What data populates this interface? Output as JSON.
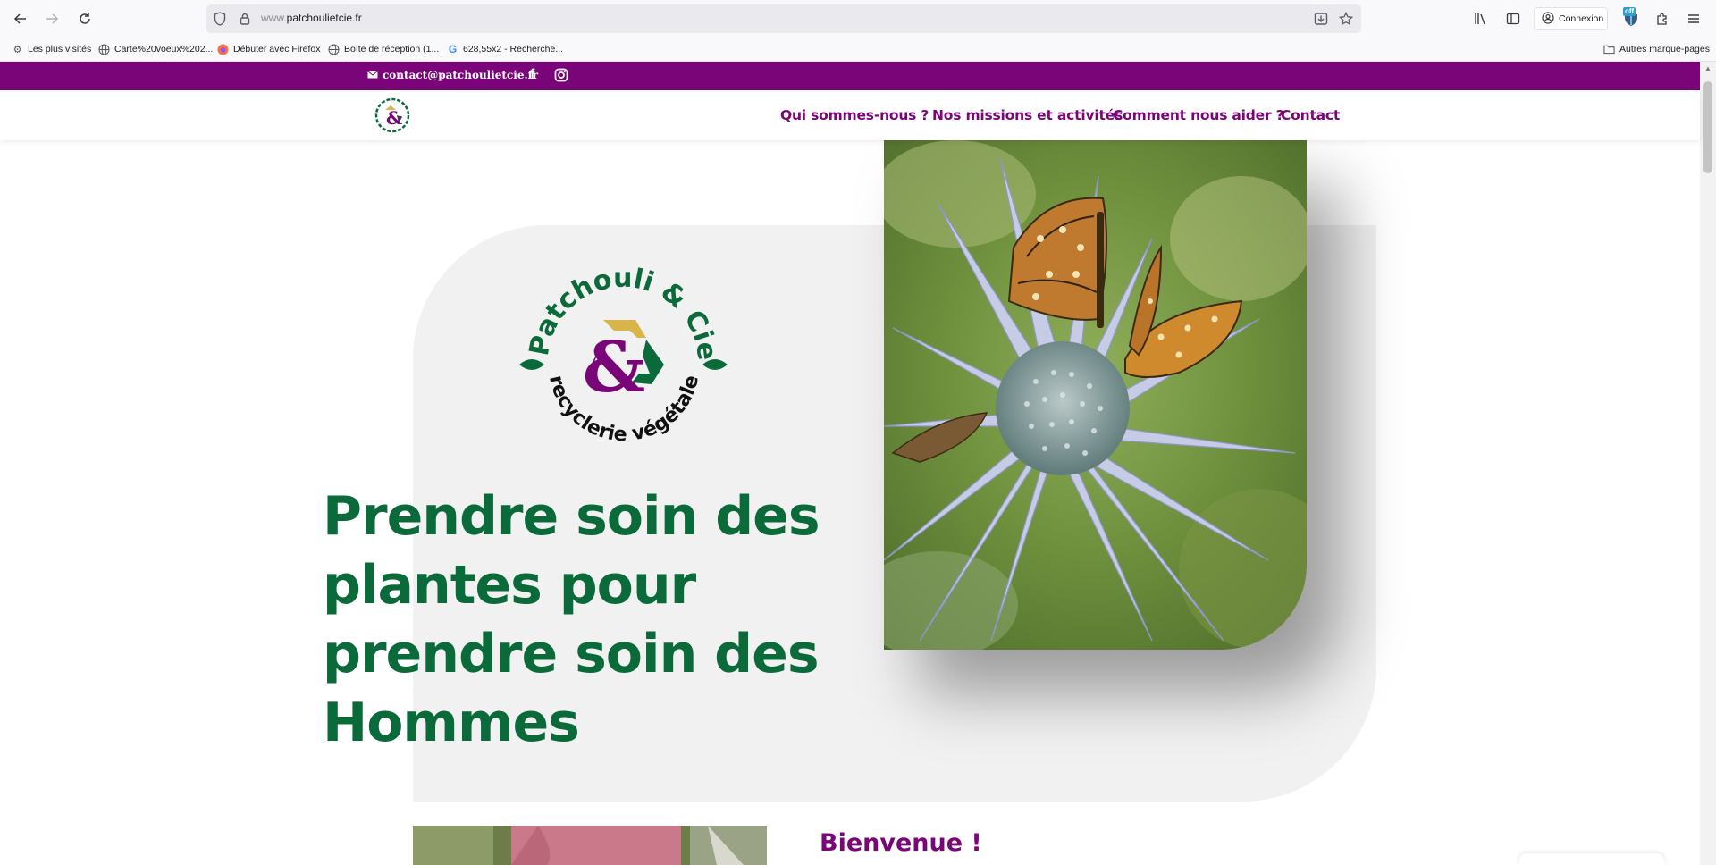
{
  "browser": {
    "url_prefix": "www.",
    "url_domain": "patchoulietcie.fr",
    "connexion_label": "Connexion",
    "extension_badge": "off",
    "bookmarks": [
      {
        "label": "Les plus visités",
        "icon": "gear-icon"
      },
      {
        "label": "Carte%20voeux%202...",
        "icon": "globe-icon"
      },
      {
        "label": "Débuter avec Firefox",
        "icon": "firefox-icon"
      },
      {
        "label": "Boîte de réception (1...",
        "icon": "globe-icon"
      },
      {
        "label": "628,55x2 - Recherche...",
        "icon": "google-icon"
      }
    ],
    "other_bookmarks_label": "Autres marque-pages"
  },
  "site": {
    "topbar": {
      "email": "contact@patchoulietcie.fr",
      "background": "#790579"
    },
    "menu": [
      "Qui sommes-nous ?",
      "Nos missions et activités",
      "Comment nous aider ?",
      "Contact"
    ],
    "logo": {
      "arc_text": "Patchouli & Cie",
      "bottom_text": "recyclerie végétale",
      "ampersand": "&"
    },
    "hero": {
      "title_lines": [
        "Prendre soin des",
        "plantes pour",
        "prendre soin des",
        "Hommes"
      ]
    },
    "welcome_heading": "Bienvenue !",
    "colors": {
      "purple": "#790579",
      "green": "#0b6a3a",
      "gold": "#d8b44a"
    }
  }
}
